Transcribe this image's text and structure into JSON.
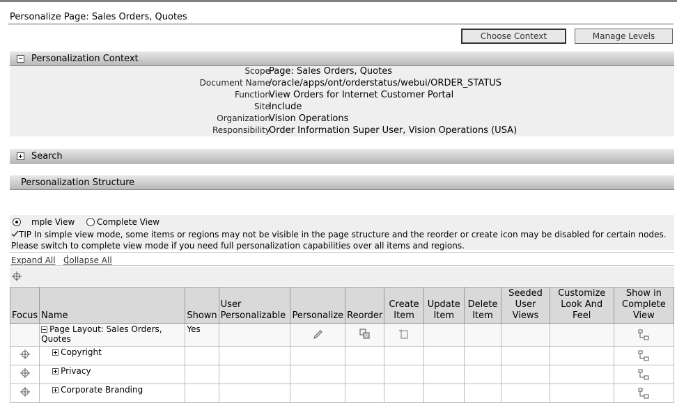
{
  "page": {
    "title": "Personalize Page: Sales Orders, Quotes"
  },
  "buttons": {
    "choose_context": "Choose Context",
    "manage_levels": "Manage Levels"
  },
  "context": {
    "header": "Personalization Context",
    "rows": [
      {
        "label": "Scope",
        "value": "Page: Sales Orders, Quotes"
      },
      {
        "label": "Document Name",
        "value": "/oracle/apps/ont/orderstatus/webui/ORDER_STATUS"
      },
      {
        "label": "Function",
        "value": "View Orders for Internet Customer Portal"
      },
      {
        "label": "Site",
        "value": "Include"
      },
      {
        "label": "Organization",
        "value": "Vision Operations"
      },
      {
        "label": "Responsibility",
        "value": "Order Information Super User, Vision Operations (USA)"
      }
    ]
  },
  "search": {
    "header": "Search"
  },
  "structure": {
    "header": "Personalization Structure",
    "view_simple": "mple View",
    "view_complete": "Complete View",
    "tip_label": "TIP",
    "tip_text": " In simple view mode, some items or regions may not be visible in the page structure and the reorder or create icon may be disabled for certain nodes. Please switch to complete view mode if you need full personalization capabilities over all items and regions.",
    "expand_all": "Expand All",
    "collapse_all": "Collapse All"
  },
  "table": {
    "headers": [
      "Focus",
      "Name",
      "Shown",
      "User Personalizable",
      "Personalize",
      "Reorder",
      "Create Item",
      "Update Item",
      "Delete Item",
      "Seeded User Views",
      "Customize Look And Feel",
      "Show in Complete View"
    ],
    "rows": [
      {
        "name": "Page Layout: Sales Orders, Quotes",
        "shown": "Yes"
      },
      {
        "name": "Copyright",
        "shown": ""
      },
      {
        "name": "Privacy",
        "shown": ""
      },
      {
        "name": "Corporate Branding",
        "shown": ""
      }
    ]
  }
}
